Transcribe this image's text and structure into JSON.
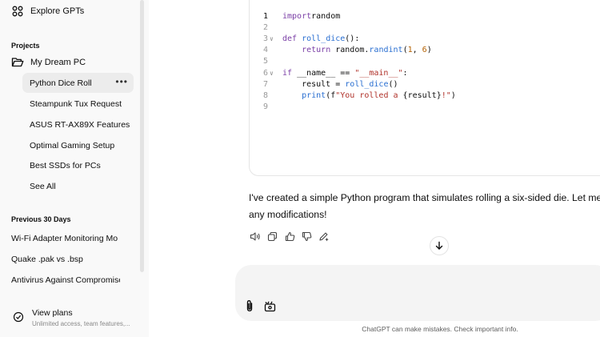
{
  "sidebar": {
    "explore_label": "Explore GPTs",
    "projects_heading": "Projects",
    "project_name": "My Dream PC",
    "project_items": [
      {
        "label": "Python Dice Roll",
        "active": true
      },
      {
        "label": "Steampunk Tux Request"
      },
      {
        "label": "ASUS RT-AX89X Features"
      },
      {
        "label": "Optimal Gaming Setup"
      },
      {
        "label": "Best SSDs for PCs"
      },
      {
        "label": "See All"
      }
    ],
    "more_dots": "•••",
    "previous_heading": "Previous 30 Days",
    "previous_items": [
      "Wi-Fi Adapter Monitoring Mo",
      "Quake .pak vs .bsp",
      "Antivirus Against Compromise"
    ],
    "plans_title": "View plans",
    "plans_subtitle": "Unlimited access, team features,..."
  },
  "code": {
    "lines": [
      {
        "n": "1",
        "tokens": [
          [
            "kw",
            "import"
          ],
          [
            "",
            "random"
          ]
        ]
      },
      {
        "n": "2",
        "tokens": []
      },
      {
        "n": "3",
        "fold": true,
        "tokens": [
          [
            "kw",
            "def "
          ],
          [
            "fn",
            "roll_dice"
          ],
          [
            "",
            "():"
          ]
        ]
      },
      {
        "n": "4",
        "tokens": [
          [
            "",
            "    "
          ],
          [
            "kw",
            "return "
          ],
          [
            "",
            "random."
          ],
          [
            "fn",
            "randint"
          ],
          [
            "",
            "("
          ],
          [
            "nm",
            "1"
          ],
          [
            "",
            ", "
          ],
          [
            "nm",
            "6"
          ],
          [
            "",
            ")"
          ]
        ]
      },
      {
        "n": "5",
        "tokens": []
      },
      {
        "n": "6",
        "fold": true,
        "tokens": [
          [
            "kw",
            "if "
          ],
          [
            "",
            "__name__ == "
          ],
          [
            "st",
            "\"__main__\""
          ],
          [
            "",
            ":"
          ]
        ]
      },
      {
        "n": "7",
        "tokens": [
          [
            "",
            "    result = "
          ],
          [
            "fn",
            "roll_dice"
          ],
          [
            "",
            "()"
          ]
        ]
      },
      {
        "n": "8",
        "tokens": [
          [
            "",
            "    "
          ],
          [
            "fn",
            "print"
          ],
          [
            "",
            "(f"
          ],
          [
            "st",
            "\"You rolled a "
          ],
          [
            "",
            "{result}"
          ],
          [
            "st",
            "!\""
          ],
          [
            "",
            ")"
          ]
        ]
      },
      {
        "n": "9",
        "tokens": []
      }
    ]
  },
  "message": {
    "line1": "I've created a simple Python program that simulates rolling a six-sided die. Let me know",
    "line2": "any modifications!"
  },
  "footer": {
    "disclaimer": "ChatGPT can make mistakes. Check important info."
  },
  "colors": {
    "sidebar_bg": "#f9f9f9",
    "active_item_bg": "#ececec",
    "composer_bg": "#f4f4f4",
    "keyword": "#7a3ea6",
    "function": "#2a6fd1",
    "string": "#b0322a",
    "number": "#b35f00"
  },
  "icons": {
    "explore": "grid-icon",
    "project": "folder-icon",
    "plans": "plans-icon",
    "actions": [
      "speaker-icon",
      "copy-icon",
      "thumbs-up-icon",
      "thumbs-down-icon",
      "edit-icon"
    ],
    "scroll": "arrow-down-icon",
    "composer": [
      "attach-icon",
      "tools-icon"
    ]
  }
}
